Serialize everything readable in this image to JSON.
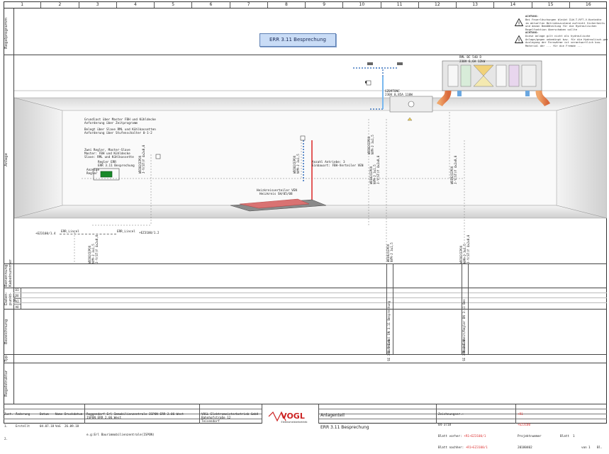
{
  "columns": [
    "1",
    "2",
    "3",
    "4",
    "5",
    "6",
    "7",
    "8",
    "9",
    "10",
    "11",
    "12",
    "13",
    "14",
    "15",
    "16"
  ],
  "row_labels": {
    "regelprogramm": "Regelprogramm",
    "anlage": "Anlage",
    "benennung": "Benennung\nKabelnummer",
    "datenpunkt": "Daten-\npunkt-\nart",
    "bezeichnung": "Bezeichnung",
    "typ": "Typ",
    "regelstruktur": "Regelstruktur"
  },
  "datapoint_types": [
    "DI",
    "DO",
    "AI",
    "AO"
  ],
  "title_button": "ERR 3.11 Besprechung",
  "warnings": [
    {
      "heading": "ACHTUNG:",
      "text": "Bei Feuerlöschungen bleibt ILW-T-RFT-V-Kontakte\nim aktuellen Betriebszustand aufrecht Sicherheits\nund davon Bemäßheitung für die Hydraulischen\nRegelfunktion überschaben sollte"
    },
    {
      "heading": "ACHTUNG:",
      "text": "Diese Anlage gilt nicht als hydraulische\nAnlage/gegen unbedingt bzw. für die Hydraulisch-ger\nAuslegung der Fernwärme ist verantwortlich bzw.\nMaterial der ... für die Fremde ..."
    }
  ],
  "ahu": {
    "label": "RML BC 540 D",
    "sub": "230V 6,6A 12kW"
  },
  "vav": {
    "label": "GZ09TONC",
    "sub": "230V 0,85A 110W"
  },
  "notes": [
    "Grundlast über Master FBH und Kühldecke\nAnforderung über Zeitprogramm",
    "Belegt über Slave RML und Kühlkassetten\nAnforderung über Stufenschalter 0-1-2",
    "Zwei Regler, Master-Slave\nMaster: FBH und Kühldecke\nSlave: RML und Kühlkassette"
  ],
  "controller": {
    "title": "Regler ERR",
    "sub": "ERR 3.11 Besprechung",
    "anzeige": "Anzeige\nRegler"
  },
  "drives": {
    "count_label": "Anzahl Antriebe: 3",
    "location": "Einbauort: FBH-Verteiler VEN"
  },
  "manifold": {
    "title": "Heizkreisverteiler VEN",
    "sub": "Heizkreis SH/05/08"
  },
  "cables": {
    "left1": "+EZ3100/1.4",
    "err1": "ERR_Lincel",
    "err2": "ERR_Lincel",
    "right1": "+EZ3100/1.2"
  },
  "vertical_tags": [
    "WDI02CEPOX\nNYM-J 3x1,5\nJ-Y(ST)Y 4x2x0,8",
    "WDI02CEPOX\nJ-Y(ST)Y 4x2x0,8",
    "WDI02CEPOX\nNYM-J 3x1,5",
    "WDI02CEPOX\nJ-Y(ST)Y 4x2x0,8",
    "WDI02CEPOX\nNYM-J 3x1,5\nJ-Y(ST)Y 4x2x0,8"
  ],
  "bezeichnung_tags": [
    "Luftkanal DN 3.11 Besprechung",
    "Raumeinheit/Regler DN 3.11 Bes"
  ],
  "type_tags": [
    "SE 360 4-E-N",
    "SE 360 4-E-N"
  ],
  "titleblock": {
    "headers": [
      "Zust.",
      "Änderung",
      "Datum",
      "Name",
      "Druckdatum"
    ],
    "rows": [
      [
        "1.",
        "Erstellt",
        "04.07.18",
        "VoG",
        "26.09.18"
      ],
      [
        "2.",
        "",
        "",
        "",
        ""
      ]
    ],
    "project": "Roggendorf Erl Immobilienzentrale ISPON ERR 2.06 West\nISPON ERR 2.06 West",
    "project2": "e.g:Erl Baurimmobilienzentrale(ISPON)",
    "company": "VOGL Elektromeisterbetrieb GmbH\nBahnhofstraße 12\nTeisendorf",
    "logo": "VOGL",
    "logo_sub": "Elektromeisterbetrieb",
    "title_main": "Anlagenteil",
    "title_sub": "ERR 3.11 Besprechung",
    "drawing_no_label": "Zeichnungsnr.:",
    "drawing_no": "04-3718",
    "blatt_vorher_label": "Blatt vorher:",
    "blatt_vorher": "+R1+EZ3100/1",
    "blatt_nachher_label": "Blatt nachher:",
    "blatt_nachher": "+R1+EZ3100/1",
    "plus": "+R1",
    "ez": "+EZ3100",
    "projektnr_label": "Projektnummer",
    "projektnr": "20180402",
    "blatt_label": "Blatt",
    "blatt": "1",
    "von_label": "von",
    "von": "1",
    "bl_label": "Bl."
  }
}
